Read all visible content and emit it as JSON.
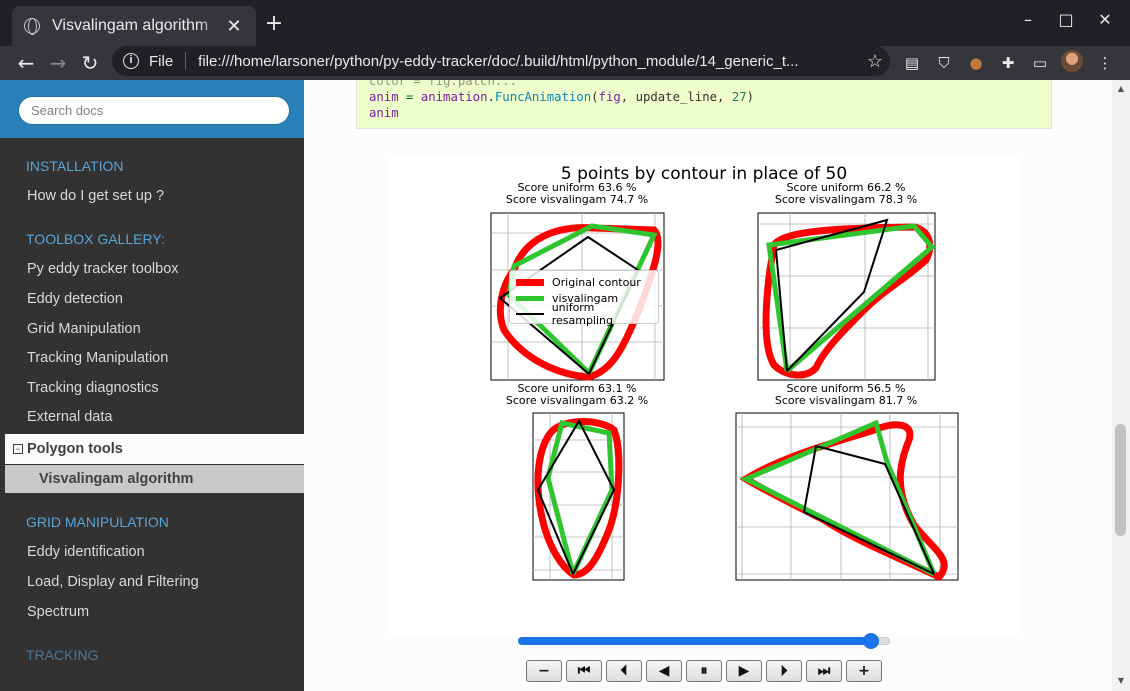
{
  "browser": {
    "tab_title": "Visvalingam algorithm",
    "tab_close": "✕",
    "new_tab": "+",
    "min": "–",
    "max": "□",
    "close": "✕",
    "scheme": "File",
    "url": "file:///home/larsoner/python/py-eddy-tracker/doc/.build/html/python_module/14_generic_t..."
  },
  "sidebar": {
    "search_placeholder": "Search docs",
    "captions": [
      "INSTALLATION",
      "TOOLBOX GALLERY:",
      "GRID MANIPULATION",
      "TRACKING"
    ],
    "installation": [
      "How do I get set up ?"
    ],
    "toolbox": [
      "Py eddy tracker toolbox",
      "Eddy detection",
      "Grid Manipulation",
      "Tracking Manipulation",
      "Tracking diagnostics",
      "External data"
    ],
    "current": "Polygon tools",
    "current_sub": "Visvalingam algorithm",
    "grid": [
      "Eddy identification",
      "Load, Display and Filtering",
      "Spectrum"
    ]
  },
  "code": {
    "line0": "color = fig.patch...",
    "line1_a": "anim",
    "line1_b": " = ",
    "line1_c": "animation",
    "line1_d": ".",
    "line1_e": "FuncAnimation",
    "line1_f": "(",
    "line1_g": "fig",
    "line1_h": ", update_line, ",
    "line1_i": "27",
    "line1_j": ")",
    "line2": "anim"
  },
  "figure": {
    "title": "5 points by contour in place of 50",
    "subplots": [
      {
        "uniform": "Score uniform 63.6 %",
        "visvalingam": "Score visvalingam 74.7 %"
      },
      {
        "uniform": "Score uniform 66.2 %",
        "visvalingam": "Score visvalingam 78.3 %"
      },
      {
        "uniform": "Score uniform 63.1 %",
        "visvalingam": "Score visvalingam 63.2 %"
      },
      {
        "uniform": "Score uniform 56.5 %",
        "visvalingam": "Score visvalingam 81.7 %"
      }
    ],
    "legend": [
      "Original contour",
      "visvalingam",
      "uniform resampling"
    ],
    "colors": {
      "original": "#ff0000",
      "visvalingam": "#2ec52e",
      "uniform": "#000000"
    }
  },
  "controls": {
    "buttons": [
      "−",
      "⏮",
      "⏴︎",
      "◀",
      "⏸",
      "▶",
      "⏵︎",
      "⏭",
      "+"
    ],
    "frame_fraction": 0.95
  }
}
